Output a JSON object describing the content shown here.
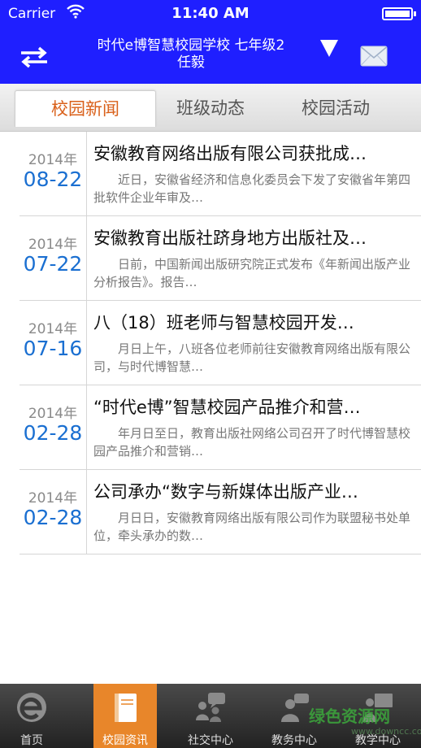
{
  "status_bar": {
    "carrier": "Carrier",
    "time": "11:40 AM"
  },
  "header": {
    "title_line1": "时代e博智慧校园学校 七年级2",
    "title_line2": "任毅",
    "swap_icon": "swap-arrows-icon",
    "dropdown_icon": "triangle-down-icon",
    "mail_icon": "envelope-icon"
  },
  "tabs": [
    {
      "label": "校园新闻",
      "active": true
    },
    {
      "label": "班级动态",
      "active": false
    },
    {
      "label": "校园活动",
      "active": false
    }
  ],
  "news": [
    {
      "year": "2014年",
      "date": "08-22",
      "title": "安徽教育网络出版有限公司获批成…",
      "summary": "近日，安徽省经济和信息化委员会下发了安徽省年第四批软件企业年审及…"
    },
    {
      "year": "2014年",
      "date": "07-22",
      "title": "安徽教育出版社跻身地方出版社及…",
      "summary": "日前，中国新闻出版研究院正式发布《年新闻出版产业分析报告》。报告…"
    },
    {
      "year": "2014年",
      "date": "07-16",
      "title": "八（18）班老师与智慧校园开发…",
      "summary": "月日上午，八班各位老师前往安徽教育网络出版有限公司，与时代博智慧…"
    },
    {
      "year": "2014年",
      "date": "02-28",
      "title": "“时代e博”智慧校园产品推介和营…",
      "summary": "年月日至日，教育出版社网络公司召开了时代博智慧校园产品推介和营销…"
    },
    {
      "year": "2014年",
      "date": "02-28",
      "title": "公司承办“数字与新媒体出版产业…",
      "summary": "月日日，安徽教育网络出版有限公司作为联盟秘书处单位，牵头承办的数…"
    }
  ],
  "tabbar": [
    {
      "label": "首页",
      "icon": "e-logo-icon",
      "active": false
    },
    {
      "label": "校园资讯",
      "icon": "book-icon",
      "active": true
    },
    {
      "label": "社交中心",
      "icon": "people-chat-icon",
      "active": false
    },
    {
      "label": "教务中心",
      "icon": "person-chat-icon",
      "active": false
    },
    {
      "label": "教学中心",
      "icon": "teacher-board-icon",
      "active": false
    }
  ],
  "watermark": {
    "text": "绿色资源网",
    "sub": "www.downcc.com"
  },
  "colors": {
    "header_bg": "#1f1fff",
    "active_tab": "#d9601a",
    "date_blue": "#1a6fd1",
    "tabbar_active": "#e8862a"
  }
}
